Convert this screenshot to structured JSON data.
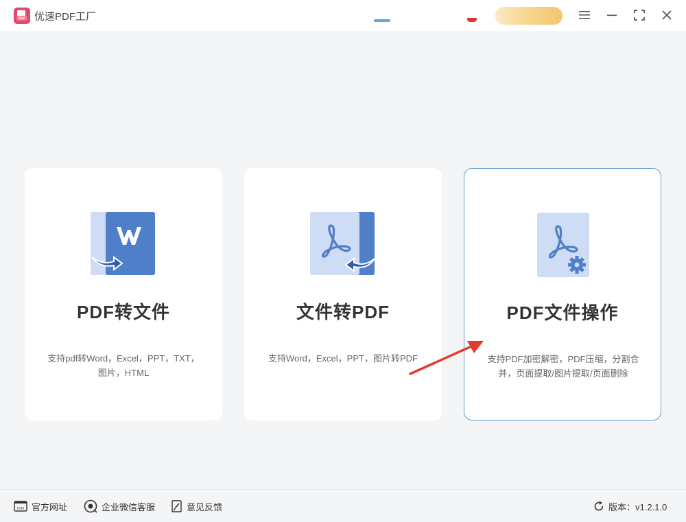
{
  "app": {
    "title": "优速PDF工厂",
    "accent_color": "#e04a6c"
  },
  "window_controls": [
    {
      "name": "menu",
      "icon": "hamburger-menu-icon"
    },
    {
      "name": "minimize",
      "icon": "minimize-icon"
    },
    {
      "name": "maximize",
      "icon": "maximize-icon"
    },
    {
      "name": "close",
      "icon": "close-icon"
    }
  ],
  "cards": [
    {
      "icon": "pdf-to-word-icon",
      "title": "PDF转文件",
      "desc_line1": "支持pdf转Word，Excel，PPT，TXT，",
      "desc_line2": "图片，HTML"
    },
    {
      "icon": "file-to-pdf-icon",
      "title": "文件转PDF",
      "desc_line1": "支持Word，Excel，PPT，图片转PDF",
      "desc_line2": ""
    },
    {
      "icon": "pdf-operations-icon",
      "title": "PDF文件操作",
      "desc_line1": "支持PDF加密解密，PDF压缩，分割合",
      "desc_line2": "并，页面提取/图片提取/页面删除",
      "selected": true
    }
  ],
  "annotation": {
    "icon": "red-arrow-annotation",
    "color": "#e63a2e"
  },
  "footer": {
    "website": "官方网址",
    "wechat_service": "企业微信客服",
    "feedback": "意见反馈",
    "version": "版本：v1.2.1.0"
  },
  "colors": {
    "icon_dark_blue": "#4f7fc9",
    "icon_light_blue": "#cfdcf5",
    "selected_border": "#5b9bd5"
  }
}
